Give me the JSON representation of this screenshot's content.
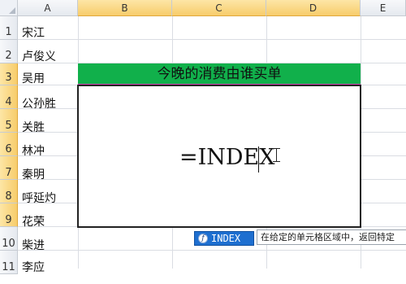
{
  "columns": [
    "A",
    "B",
    "C",
    "D",
    "E"
  ],
  "rows": [
    "1",
    "2",
    "3",
    "4",
    "5",
    "6",
    "7",
    "8",
    "9",
    "10",
    "11"
  ],
  "column_a_values": [
    "宋江",
    "卢俊义",
    "吴用",
    "公孙胜",
    "关胜",
    "林冲",
    "秦明",
    "呼延灼",
    "花荣",
    "柴进",
    "李应"
  ],
  "banner_text": "今晚的消费由谁买单",
  "formula_text": "=INDEX",
  "autocomplete": {
    "item_label": "INDEX",
    "item_icon": "function-icon",
    "tooltip": "在给定的单元格区域中，返回特定"
  },
  "colors": {
    "banner_green": "#11b04b",
    "selected_header": "#f7cc6b",
    "autocomplete_blue": "#1e6fd0"
  }
}
